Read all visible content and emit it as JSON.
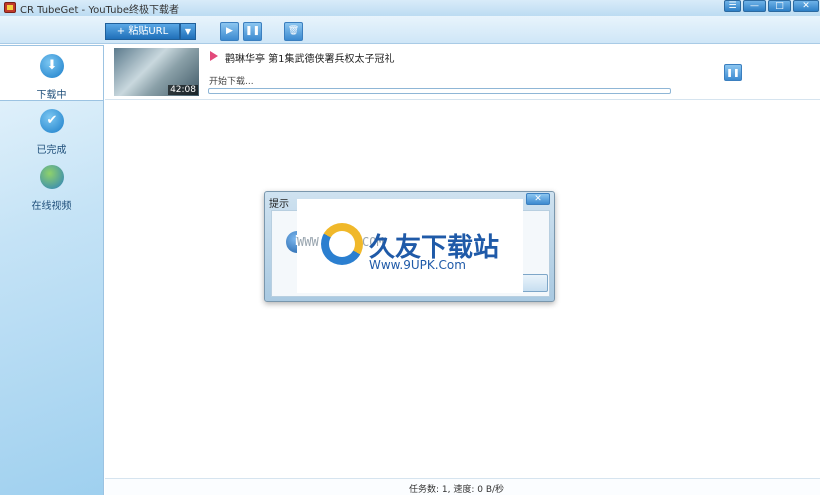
{
  "window": {
    "title": "CR TubeGet - YouTube终极下载者",
    "controls": {
      "menu": "☰",
      "min": "—",
      "max": "□",
      "close": "✕"
    }
  },
  "toolbar": {
    "paste_url_label": "+ 粘贴URL",
    "dropdown_glyph": "▼",
    "play_glyph": "▶",
    "pause_glyph": "❚❚",
    "delete_glyph": "🗑"
  },
  "sidebar": {
    "items": [
      {
        "label": "下载中",
        "icon": "download-icon",
        "active": true
      },
      {
        "label": "已完成",
        "icon": "check-icon",
        "active": false
      },
      {
        "label": "在线视频",
        "icon": "globe-icon",
        "active": false
      }
    ]
  },
  "download": {
    "title": "鹳琳华亭 第1集武德侠署兵权太子冠礼",
    "duration": "42:08",
    "status": "开始下载...",
    "progress": 0.0,
    "pause_glyph": "❚❚"
  },
  "statusbar": {
    "text": "任务数: 1, 速度: 0 B/秒"
  },
  "dialog": {
    "title": "提示",
    "close_glyph": "✕",
    "info_glyph": "i",
    "message": "..."
  },
  "watermark": {
    "cn": "久友下载站",
    "url": "Www.9UPK.Com",
    "ghost": "WWW.9UPK.COM"
  },
  "colors": {
    "accent": "#2d7fc6",
    "sidebar": "#c5e3f6"
  }
}
